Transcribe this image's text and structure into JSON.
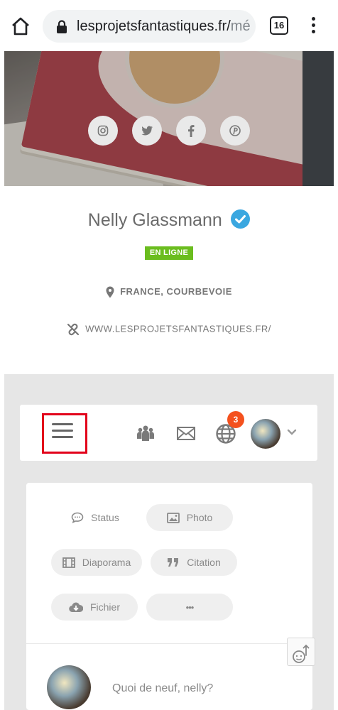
{
  "browser": {
    "url_main": "lesprojetsfantastiques.fr/",
    "url_fade": "mé",
    "tab_count": "16",
    "icons": [
      "home-icon",
      "lock-icon",
      "tabs-icon",
      "more-vert-icon"
    ]
  },
  "cover": {
    "socials": [
      {
        "name": "instagram-icon",
        "glyph": "▣"
      },
      {
        "name": "twitter-icon",
        "glyph": "🐦"
      },
      {
        "name": "facebook-icon",
        "glyph": "f"
      },
      {
        "name": "pinterest-icon",
        "glyph": "℗"
      }
    ]
  },
  "profile": {
    "name": "Nelly Glassmann",
    "status": "EN LIGNE",
    "location": "FRANCE, COURBEVOIE",
    "website": "WWW.LESPROJETSFANTASTIQUES.FR/"
  },
  "toolbar": {
    "notification_count": "3",
    "icons": [
      "menu-icon",
      "groups-icon",
      "mail-icon",
      "globe-icon",
      "avatar",
      "chevron-down-icon"
    ]
  },
  "composer": {
    "actions": {
      "status": "Status",
      "photo": "Photo",
      "slideshow": "Diaporama",
      "quote": "Citation",
      "file": "Fichier",
      "more": "•••"
    },
    "placeholder": "Quoi de neuf, nelly?"
  },
  "colors": {
    "accent_red": "#e2001a",
    "online_green": "#6bbd1f",
    "verified_blue": "#3aa7e0",
    "badge_orange": "#f4511e"
  }
}
